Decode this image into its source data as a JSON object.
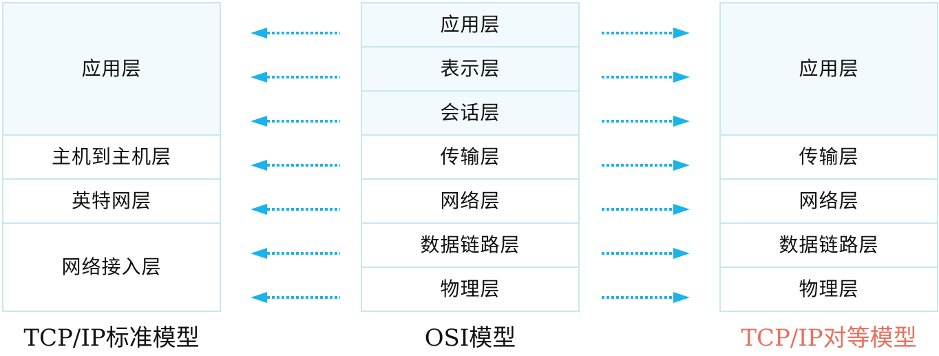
{
  "colors": {
    "border": "#c7e7ef",
    "tint_fill": "#f2fafd",
    "arrow": "#1ab3ea",
    "highlight_caption": "#e8705f"
  },
  "left_model": {
    "caption": "TCP/IP标准模型",
    "layers": [
      {
        "label": "应用层",
        "span": 3,
        "tint": true
      },
      {
        "label": "主机到主机层",
        "span": 1,
        "tint": false
      },
      {
        "label": "英特网层",
        "span": 1,
        "tint": false
      },
      {
        "label": "网络接入层",
        "span": 2,
        "tint": false
      }
    ]
  },
  "osi_model": {
    "caption": "OSI模型",
    "layers": [
      {
        "label": "应用层",
        "span": 1,
        "tint": true
      },
      {
        "label": "表示层",
        "span": 1,
        "tint": true
      },
      {
        "label": "会话层",
        "span": 1,
        "tint": true
      },
      {
        "label": "传输层",
        "span": 1,
        "tint": false
      },
      {
        "label": "网络层",
        "span": 1,
        "tint": false
      },
      {
        "label": "数据链路层",
        "span": 1,
        "tint": false
      },
      {
        "label": "物理层",
        "span": 1,
        "tint": false
      }
    ]
  },
  "right_model": {
    "caption": "TCP/IP对等模型",
    "layers": [
      {
        "label": "应用层",
        "span": 3,
        "tint": true
      },
      {
        "label": "传输层",
        "span": 1,
        "tint": false
      },
      {
        "label": "网络层",
        "span": 1,
        "tint": false
      },
      {
        "label": "数据链路层",
        "span": 1,
        "tint": false
      },
      {
        "label": "物理层",
        "span": 1,
        "tint": false
      }
    ]
  },
  "arrows": {
    "left_direction": "left",
    "right_direction": "right",
    "count_per_side": 7,
    "style": "dotted"
  }
}
